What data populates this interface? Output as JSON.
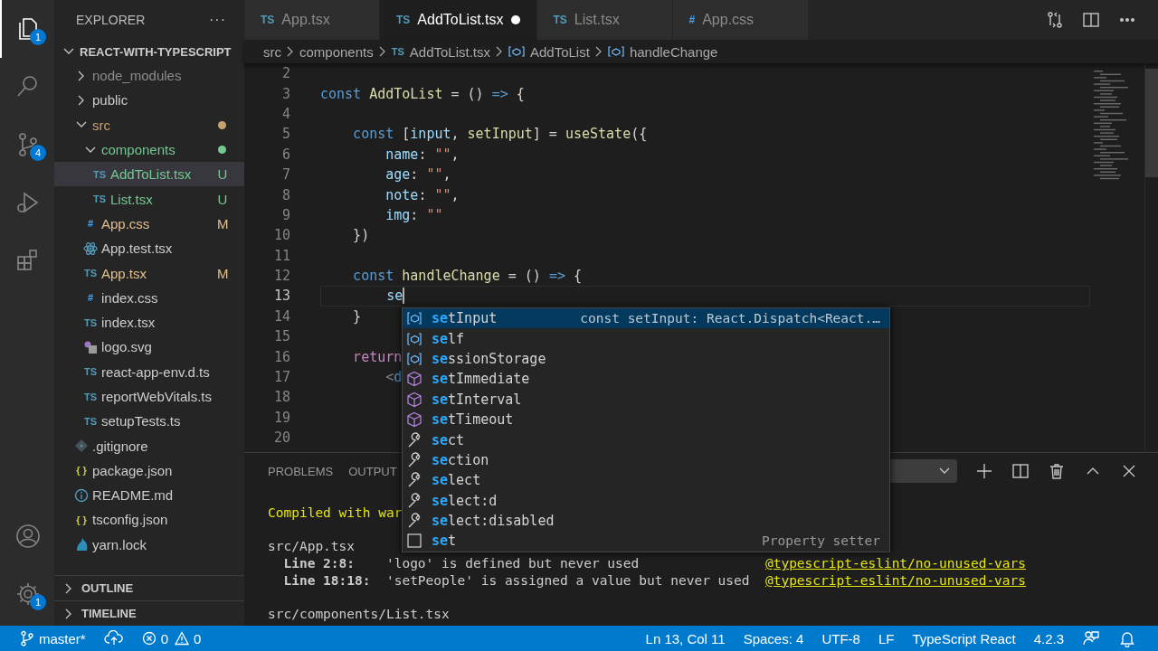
{
  "activity_bar": {
    "top": [
      {
        "kind": "explorer",
        "selected": true,
        "badge": "1"
      },
      {
        "kind": "search",
        "selected": false
      },
      {
        "kind": "source_control",
        "selected": false,
        "badge": "4"
      },
      {
        "kind": "run",
        "selected": false
      },
      {
        "kind": "extensions",
        "selected": false
      }
    ],
    "bottom": [
      {
        "kind": "account",
        "selected": false
      },
      {
        "kind": "settings",
        "selected": false,
        "badge": "1"
      }
    ]
  },
  "sidebar": {
    "title": "EXPLORER",
    "more": "···",
    "root": {
      "label": "REACT-WITH-TYPESCRIPT",
      "expanded": true
    },
    "tree": [
      {
        "kind": "folder",
        "label": "node_modules",
        "expanded": false,
        "color": "#8c8c8c",
        "selected": false
      },
      {
        "kind": "folder",
        "label": "public",
        "expanded": false,
        "selected": false
      },
      {
        "kind": "folder",
        "label": "src",
        "expanded": true,
        "color": "#c9a26d",
        "selected": false,
        "children": [
          {
            "kind": "folder",
            "label": "components",
            "expanded": true,
            "color": "#73c991",
            "selected": false,
            "children": [
              {
                "kind": "ts",
                "label": "AddToList.tsx",
                "glyph": "TS",
                "color": "#73c991",
                "badge": "U",
                "selected": true
              },
              {
                "kind": "ts",
                "label": "List.tsx",
                "glyph": "TS",
                "color": "#73c991",
                "badge": "U",
                "selected": false
              }
            ]
          },
          {
            "kind": "css",
            "label": "App.css",
            "glyph": "#",
            "color": "#e2c08d",
            "badge": "M",
            "selected": false
          },
          {
            "kind": "react",
            "label": "App.test.tsx",
            "selected": false
          },
          {
            "kind": "ts",
            "label": "App.tsx",
            "glyph": "TS",
            "color": "#e2c08d",
            "badge": "M",
            "selected": false
          },
          {
            "kind": "css",
            "label": "index.css",
            "glyph": "#",
            "selected": false
          },
          {
            "kind": "ts",
            "label": "index.tsx",
            "glyph": "TS",
            "selected": false
          },
          {
            "kind": "svg",
            "label": "logo.svg",
            "selected": false
          },
          {
            "kind": "ts",
            "label": "react-app-env.d.ts",
            "glyph": "TS",
            "selected": false
          },
          {
            "kind": "ts",
            "label": "reportWebVitals.ts",
            "glyph": "TS",
            "selected": false
          },
          {
            "kind": "ts",
            "label": "setupTests.ts",
            "glyph": "TS",
            "selected": false
          }
        ]
      },
      {
        "kind": "git",
        "label": ".gitignore",
        "selected": false
      },
      {
        "kind": "json",
        "label": "package.json",
        "glyph": "{ }",
        "selected": false
      },
      {
        "kind": "info",
        "label": "README.md",
        "selected": false
      },
      {
        "kind": "json",
        "label": "tsconfig.json",
        "glyph": "{ }",
        "selected": false
      },
      {
        "kind": "yarn",
        "label": "yarn.lock",
        "selected": false
      }
    ],
    "sections": [
      {
        "label": "OUTLINE",
        "expanded": false
      },
      {
        "label": "TIMELINE",
        "expanded": false
      }
    ]
  },
  "tabs": [
    {
      "label": "App.tsx",
      "kind": "ts",
      "glyph": "TS",
      "selected": false,
      "dirty": false
    },
    {
      "label": "AddToList.tsx",
      "kind": "ts",
      "glyph": "TS",
      "selected": true,
      "dirty": true
    },
    {
      "label": "List.tsx",
      "kind": "ts",
      "glyph": "TS",
      "selected": false,
      "dirty": false
    },
    {
      "label": "App.css",
      "kind": "css",
      "glyph": "#",
      "selected": false,
      "dirty": false
    }
  ],
  "editor_actions": [
    {
      "kind": "compare"
    },
    {
      "kind": "split"
    },
    {
      "kind": "more"
    }
  ],
  "breadcrumb": [
    {
      "kind": "folder",
      "label": "src"
    },
    {
      "kind": "folder",
      "label": "components"
    },
    {
      "kind": "file",
      "label": "AddToList.tsx",
      "glyph": "TS"
    },
    {
      "kind": "symbol",
      "label": "AddToList"
    },
    {
      "kind": "symbol",
      "label": "handleChange"
    }
  ],
  "code": [
    {
      "n": "2",
      "current": false
    },
    {
      "n": "3",
      "current": false,
      "tokens": [
        {
          "kind": "kw",
          "t": "const"
        },
        {
          "kind": "fn",
          "t": " AddToList"
        },
        {
          "kind": "pl",
          "t": " = () "
        },
        {
          "kind": "kw",
          "t": "=>"
        },
        {
          "kind": "pl",
          "t": " {"
        }
      ]
    },
    {
      "n": "4",
      "current": false
    },
    {
      "n": "5",
      "current": false,
      "tokens": [
        {
          "kind": "kw",
          "t": "    const"
        },
        {
          "kind": "pl",
          "t": " ["
        },
        {
          "kind": "var",
          "t": "input"
        },
        {
          "kind": "pl",
          "t": ", "
        },
        {
          "kind": "fn",
          "t": "setInput"
        },
        {
          "kind": "pl",
          "t": "] = "
        },
        {
          "kind": "fn",
          "t": "useState"
        },
        {
          "kind": "pl",
          "t": "({"
        }
      ]
    },
    {
      "n": "6",
      "current": false,
      "tokens": [
        {
          "kind": "var",
          "t": "        name"
        },
        {
          "kind": "pl",
          "t": ": "
        },
        {
          "kind": "str",
          "t": "\"\""
        },
        {
          "kind": "pl",
          "t": ","
        }
      ]
    },
    {
      "n": "7",
      "current": false,
      "tokens": [
        {
          "kind": "var",
          "t": "        age"
        },
        {
          "kind": "pl",
          "t": ": "
        },
        {
          "kind": "str",
          "t": "\"\""
        },
        {
          "kind": "pl",
          "t": ","
        }
      ]
    },
    {
      "n": "8",
      "current": false,
      "tokens": [
        {
          "kind": "var",
          "t": "        note"
        },
        {
          "kind": "pl",
          "t": ": "
        },
        {
          "kind": "str",
          "t": "\"\""
        },
        {
          "kind": "pl",
          "t": ","
        }
      ]
    },
    {
      "n": "9",
      "current": false,
      "tokens": [
        {
          "kind": "var",
          "t": "        img"
        },
        {
          "kind": "pl",
          "t": ": "
        },
        {
          "kind": "str",
          "t": "\"\""
        }
      ]
    },
    {
      "n": "10",
      "current": false,
      "tokens": [
        {
          "kind": "pl",
          "t": "    })"
        }
      ]
    },
    {
      "n": "11",
      "current": false
    },
    {
      "n": "12",
      "current": false,
      "tokens": [
        {
          "kind": "kw",
          "t": "    const"
        },
        {
          "kind": "fn",
          "t": " handleChange"
        },
        {
          "kind": "pl",
          "t": " = () "
        },
        {
          "kind": "kw",
          "t": "=>"
        },
        {
          "kind": "pl",
          "t": " {"
        }
      ]
    },
    {
      "n": "13",
      "current": true,
      "tokens": [
        {
          "kind": "var",
          "t": "        se"
        }
      ]
    },
    {
      "n": "14",
      "current": false,
      "tokens": [
        {
          "kind": "pl",
          "t": "    }"
        }
      ]
    },
    {
      "n": "15",
      "current": false
    },
    {
      "n": "16",
      "current": false,
      "tokens": [
        {
          "kind": "ctrl",
          "t": "    return"
        }
      ]
    },
    {
      "n": "17",
      "current": false,
      "tokens": [
        {
          "kind": "punct",
          "t": "        <"
        },
        {
          "kind": "tag",
          "t": "d"
        }
      ]
    },
    {
      "n": "18",
      "current": false
    },
    {
      "n": "19",
      "current": false
    },
    {
      "n": "20",
      "current": false
    }
  ],
  "suggestions": [
    {
      "kind": "variable",
      "label": "**se**tInput",
      "detail": "const setInput: React.Dispatch<React.…",
      "selected": true
    },
    {
      "kind": "variable",
      "label": "**se**lf",
      "selected": false
    },
    {
      "kind": "variable",
      "label": "**se**ssionStorage",
      "selected": false
    },
    {
      "kind": "method",
      "label": "**se**tImmediate",
      "selected": false
    },
    {
      "kind": "method",
      "label": "**se**tInterval",
      "selected": false
    },
    {
      "kind": "method",
      "label": "**se**tTimeout",
      "selected": false
    },
    {
      "kind": "snippet",
      "label": "**se**ct",
      "selected": false
    },
    {
      "kind": "snippet",
      "label": "**se**ction",
      "selected": false
    },
    {
      "kind": "snippet",
      "label": "**se**lect",
      "selected": false
    },
    {
      "kind": "snippet",
      "label": "**se**lect:d",
      "selected": false
    },
    {
      "kind": "snippet",
      "label": "**se**lect:disabled",
      "selected": false
    },
    {
      "kind": "property",
      "label": "**se**t",
      "detail": "Property setter",
      "selected": false
    }
  ],
  "panel": {
    "tabs": [
      {
        "label": "PROBLEMS",
        "selected": false
      },
      {
        "label": "OUTPUT",
        "selected": false
      }
    ],
    "actions": [
      {
        "kind": "plus"
      },
      {
        "kind": "split"
      },
      {
        "kind": "trash"
      },
      {
        "kind": "maximize"
      },
      {
        "kind": "close"
      }
    ],
    "output": [
      {
        "kind": "status",
        "text": "Compiled with war"
      },
      {
        "kind": "blank"
      },
      {
        "kind": "file",
        "text": "src/App.tsx"
      },
      {
        "kind": "warning",
        "location": "Line 2:8:",
        "message": "'logo' is defined but never used",
        "rule": "@typescript-eslint/no-unused-vars"
      },
      {
        "kind": "warning",
        "location": "Line 18:18:",
        "message": "'setPeople' is assigned a value but never used",
        "rule": "@typescript-eslint/no-unused-vars"
      },
      {
        "kind": "blank"
      },
      {
        "kind": "file",
        "text": "src/components/List.tsx"
      }
    ]
  },
  "status_bar": {
    "left": [
      {
        "kind": "branch",
        "text": "master*"
      },
      {
        "kind": "sync"
      },
      {
        "kind": "problems",
        "errors": "0",
        "warnings": "0"
      }
    ],
    "right": [
      {
        "kind": "text",
        "text": "Ln 13, Col 11"
      },
      {
        "kind": "text",
        "text": "Spaces: 4"
      },
      {
        "kind": "text",
        "text": "UTF-8"
      },
      {
        "kind": "text",
        "text": "LF"
      },
      {
        "kind": "text",
        "text": "TypeScript React"
      },
      {
        "kind": "text",
        "text": "4.2.3"
      },
      {
        "kind": "feedback"
      },
      {
        "kind": "bell"
      }
    ]
  }
}
